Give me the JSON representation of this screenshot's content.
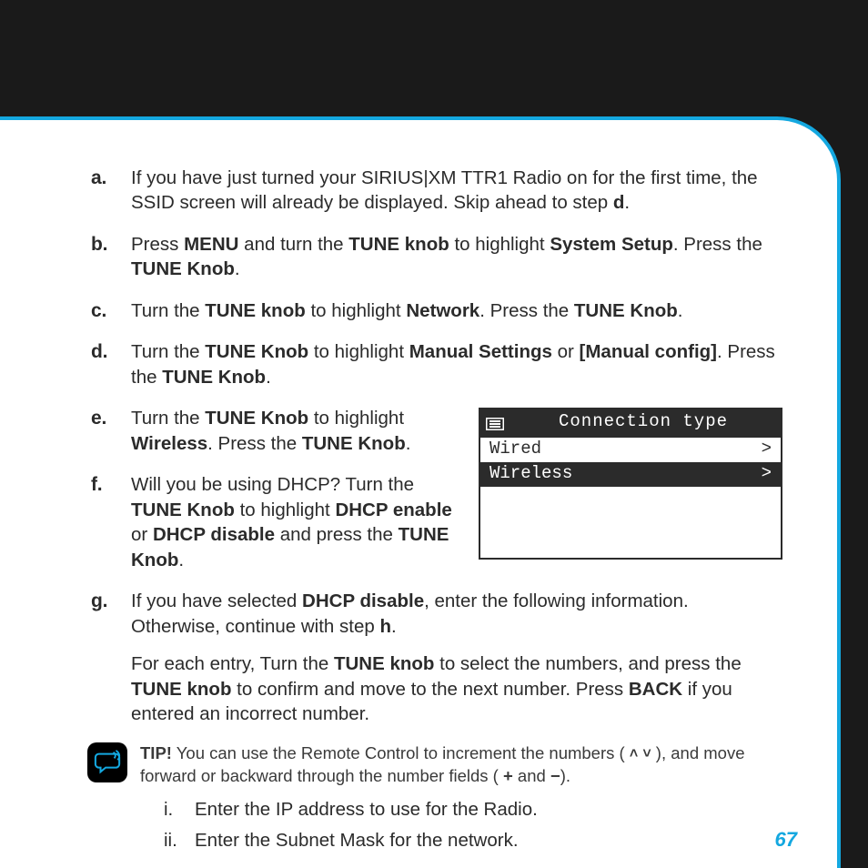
{
  "page_number": "67",
  "steps": {
    "a": {
      "marker": "a.",
      "html": "If you have just turned your SIRIUS|XM TTR1 Radio on for the first time, the SSID screen will already be displayed. Skip ahead to step <b>d</b>."
    },
    "b": {
      "marker": "b.",
      "html": "Press <b>MENU</b> and turn the <b>TUNE knob</b> to highlight <b>System Setup</b>. Press the <b>TUNE Knob</b>."
    },
    "c": {
      "marker": "c.",
      "html": "Turn the <b>TUNE knob</b> to highlight <b>Network</b>. Press the <b>TUNE Knob</b>."
    },
    "d": {
      "marker": "d.",
      "html": "Turn the <b>TUNE Knob</b> to highlight <b>Manual Settings</b> or <b>[Manual config]</b>. Press the <b>TUNE Knob</b>."
    },
    "e": {
      "marker": "e.",
      "html": "Turn the <b>TUNE Knob</b> to highlight <b>Wireless</b>. Press the <b>TUNE Knob</b>."
    },
    "f": {
      "marker": "f.",
      "html": "Will you be using DHCP? Turn the <b>TUNE Knob</b> to highlight <b>DHCP enable</b> or <b>DHCP disable</b> and press the <b>TUNE Knob</b>."
    },
    "g": {
      "marker": "g.",
      "html": "If you have selected <b>DHCP disable</b>, enter the following information. Otherwise, continue with step <b>h</b>.",
      "sub_html": "For each entry, Turn the <b>TUNE knob</b> to select the numbers, and press the <b>TUNE knob</b> to confirm and move to the next number. Press <b>BACK</b> if you entered an incorrect number."
    }
  },
  "tip": {
    "label": "TIP!",
    "html": "You can use the Remote Control to increment the numbers ( <span class='arrow'>&#708;</span>&nbsp;<span class='arrow'>&#709;</span> ), and move forward or backward through the number fields ( <b>+</b> and <b>&minus;</b>)."
  },
  "roman": {
    "i": {
      "marker": "i.",
      "text": "Enter the IP address to use for the Radio."
    },
    "ii": {
      "marker": "ii.",
      "text": "Enter the Subnet Mask for the network."
    }
  },
  "device": {
    "title": "Connection type",
    "rows": [
      {
        "label": "Wired",
        "chev": ">",
        "selected": false
      },
      {
        "label": "Wireless",
        "chev": ">",
        "selected": true
      }
    ]
  }
}
